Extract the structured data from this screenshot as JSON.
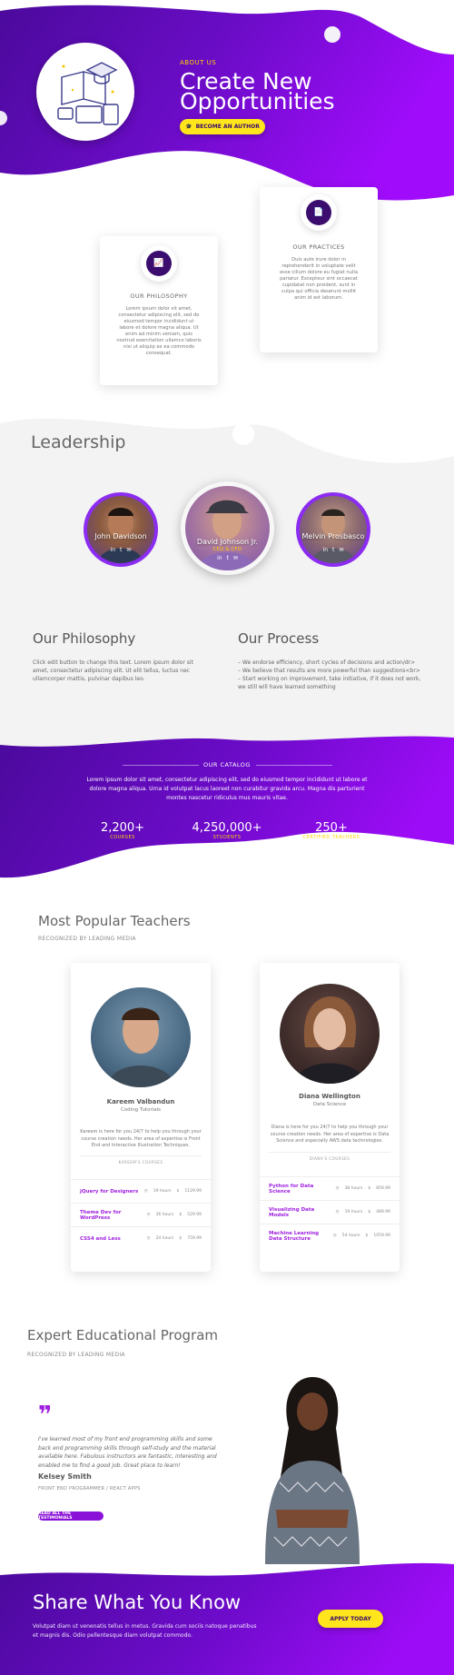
{
  "hero": {
    "eyebrow": "ABOUT US",
    "title_line1": "Create New",
    "title_line2": "Opportunities",
    "button_label": "BECOME AN AUTHOR"
  },
  "features": [
    {
      "title": "OUR PHILOSOPHY",
      "text": "Lorem ipsum dolor sit amet, consectetur adipiscing elit, sed do eiusmod tempor incididunt ut labore et dolore magna aliqua. Ut enim ad minim veniam, quis nostrud exercitation ullamco laboris nisi ut aliquip ex ea commodo consequat."
    },
    {
      "title": "OUR PRACTICES",
      "text": "Duis aute irure dolor in reprehenderit in voluptate velit esse cillum dolore eu fugiat nulla pariatur. Excepteur sint occaecat cupidatat non proident, sunt in culpa qui officia deserunt mollit anim id est laborum."
    }
  ],
  "leadership": {
    "heading": "Leadership",
    "members": [
      {
        "name": "John Davidson",
        "role": ""
      },
      {
        "name": "David Johnson Jr.",
        "role": "CEO & CFO"
      },
      {
        "name": "Melvin Prosbasco",
        "role": ""
      }
    ]
  },
  "philosophy": {
    "heading": "Our Philosophy",
    "text": "Click edit button to change this text. Lorem ipsum dolor sit amet, consectetur adipiscing elit. Ut elit tellus, luctus nec ullamcorper mattis, pulvinar dapibus leo."
  },
  "process": {
    "heading": "Our Process",
    "lines": [
      "– We endorse efficiency, short cycles of decisions and action/dr>",
      "– We believe that results are more powerful than suggestions<br>",
      "– Start working on improvement, take initiative, if it does not work, we still will have learned something"
    ]
  },
  "catalog": {
    "eyebrow": "OUR CATALOG",
    "text": "Lorem ipsum dolor sit amet, consectetur adipiscing elit, sed do eiusmod tempor incididunt ut labore et dolore magna aliqua. Urna id volutpat lacus laoreet non curabitur gravida arcu. Magna dis parturient montes nascetur ridiculus mus mauris vitae.",
    "stats": [
      {
        "value": "2,200+",
        "label": "COURSES"
      },
      {
        "value": "4,250,000+",
        "label": "STUDENTS"
      },
      {
        "value": "250+",
        "label": "CERTIFIED TEACHERS"
      }
    ]
  },
  "teachers": {
    "heading": "Most Popular Teachers",
    "subheading": "RECOGNIZED BY LEADING MEDIA",
    "list": [
      {
        "name": "Kareem Valbandun",
        "subject": "Coding Tutorials",
        "desc": "Kareem is here for you 24/7 to help you through your course creation needs. Her area of expertise is Front End and Interactive Illustration Techniques.",
        "courses_label": "KAREEM'S COURSES",
        "courses": [
          {
            "name": "jQuery for Designers",
            "hours": "19 hours",
            "price": "1129.99"
          },
          {
            "name": "Theme Dev for WordPress",
            "hours": "36 hours",
            "price": "529.99"
          },
          {
            "name": "CSS4 and Less",
            "hours": "24 hours",
            "price": "759.99"
          }
        ]
      },
      {
        "name": "Diana Wellington",
        "subject": "Data Science",
        "desc": "Diana is here for you 24/7 to help you through your course creation needs. Her area of expertise is Data Science and especially AWS data technologies.",
        "courses_label": "DIANA'S COURSES",
        "courses": [
          {
            "name": "Python for Data Science",
            "hours": "38 hours",
            "price": "859.99"
          },
          {
            "name": "Visualizing Data Models",
            "hours": "19 hours",
            "price": "489.99"
          },
          {
            "name": "Machine Learning Data Structure",
            "hours": "54 hours",
            "price": "1059.99"
          }
        ]
      }
    ]
  },
  "program": {
    "heading": "Expert Educational Program",
    "subheading": "RECOGNIZED BY LEADING MEDIA",
    "quote": "I've learned most of my front end programming skills and some back end programming skills through self-study and the material available here. Fabulous instructors are fantastic, interesting and enabled me to find a good job. Great place to learn!",
    "author": "Kelsey Smith",
    "author_role": "FRONT END PROGRAMMER / REACT APPS",
    "button_label": "READ ALL THE TESTIMONIALS"
  },
  "cta": {
    "heading": "Share What You Know",
    "text": "Volutpat diam ut venenatis tellus in metus. Gravida cum sociis natoque penatibus et magnis dis. Odio pellentesque diam volutpat commodo.",
    "button_label": "APPLY TODAY"
  },
  "icons": {
    "author_button": "graduation-cap-icon",
    "philosophy": "chart-icon",
    "practices": "document-icon",
    "quote": "quote-icon",
    "clock": "clock-icon",
    "price": "dollar-icon"
  },
  "colors": {
    "brand_purple": "#6c0bc9",
    "accent_yellow": "#ffe61c",
    "link_purple": "#a020e0"
  }
}
